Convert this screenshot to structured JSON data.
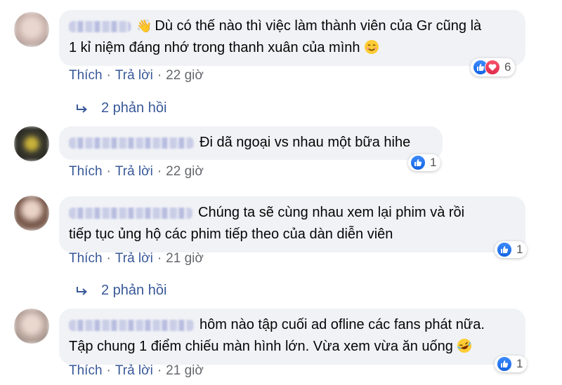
{
  "comments": [
    {
      "text": "Dù có thế nào thì việc làm thành viên của Gr cũng là 1 kỉ niệm đáng nhớ trong thanh xuân của mình",
      "line1": "Dù có thế nào thì việc làm thành viên của Gr cũng là",
      "line2": "1 kỉ niệm đáng nhớ trong thanh xuân của mình",
      "emoji": "smiling-face-emoji",
      "like_label": "Thích",
      "reply_label": "Trả lời",
      "time": "22 giờ",
      "reaction_count": "6",
      "reactions": [
        "like",
        "love"
      ],
      "replies_label": "2 phản hồi"
    },
    {
      "line1": "Đi dã ngoại vs nhau một bữa hihe",
      "like_label": "Thích",
      "reply_label": "Trả lời",
      "time": "22 giờ",
      "reaction_count": "1",
      "reactions": [
        "like"
      ]
    },
    {
      "line1": "Chúng ta sẽ cùng nhau xem lại phim và rồi",
      "line2": "tiếp tục ủng hộ các phim tiếp theo của dàn diễn viên",
      "like_label": "Thích",
      "reply_label": "Trả lời",
      "time": "21 giờ",
      "reaction_count": "1",
      "reactions": [
        "like"
      ],
      "replies_label": "2 phản hồi"
    },
    {
      "line1": "hôm nào tập cuối ad ofline các fans phát nữa.",
      "line2": "Tập chung 1 điểm chiếu màn hình lớn. Vừa xem vừa ăn uống",
      "emoji": "rolling-laughing-emoji",
      "like_label": "Thích",
      "reply_label": "Trả lời",
      "time": "21 giờ",
      "reaction_count": "1",
      "reactions": [
        "like"
      ]
    }
  ],
  "colors": {
    "link": "#385898",
    "meta": "#65676b",
    "bubble": "#f0f2f5",
    "like": "#1877f2",
    "love": "#f33e58"
  }
}
